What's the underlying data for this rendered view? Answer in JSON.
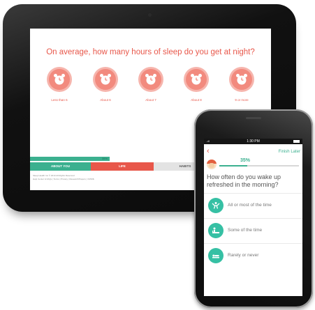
{
  "tablet": {
    "question": "On average, how many hours of sleep do you get at night?",
    "options": [
      {
        "label": "Less than 6",
        "icon": "alarm-clock-icon"
      },
      {
        "label": "About 6",
        "icon": "alarm-clock-icon"
      },
      {
        "label": "About 7",
        "icon": "alarm-clock-icon"
      },
      {
        "label": "About 8",
        "icon": "alarm-clock-icon"
      },
      {
        "label": "9 or more",
        "icon": "alarm-clock-icon"
      }
    ],
    "progress_percent": "35%",
    "progress_fraction": 0.33,
    "sections": [
      "ABOUT YOU",
      "LIFE",
      "HABITS",
      ""
    ],
    "footer_line1": "Sleep Health Inc © 2013 All Rights Reserved",
    "footer_line2": "Help Center & FAQs | Terms | Privacy | Research/Papers | CMS/fk"
  },
  "phone": {
    "status": {
      "signal": "..ıll",
      "time": "1:30 PM"
    },
    "back_icon": "chevron-left-icon",
    "finish_label": "Finish Later",
    "progress_percent": "35%",
    "progress_fraction": 0.35,
    "question": "How often do you wake up refreshed in the morning?",
    "answers": [
      {
        "label": "All or most of the time",
        "icon": "person-jumping-icon"
      },
      {
        "label": "Some of the time",
        "icon": "person-sitting-up-icon"
      },
      {
        "label": "Rarely or never",
        "icon": "person-lying-icon"
      }
    ]
  },
  "colors": {
    "accent_red": "#e8574a",
    "accent_green": "#3bb08f",
    "answer_teal": "#36c0a4"
  }
}
